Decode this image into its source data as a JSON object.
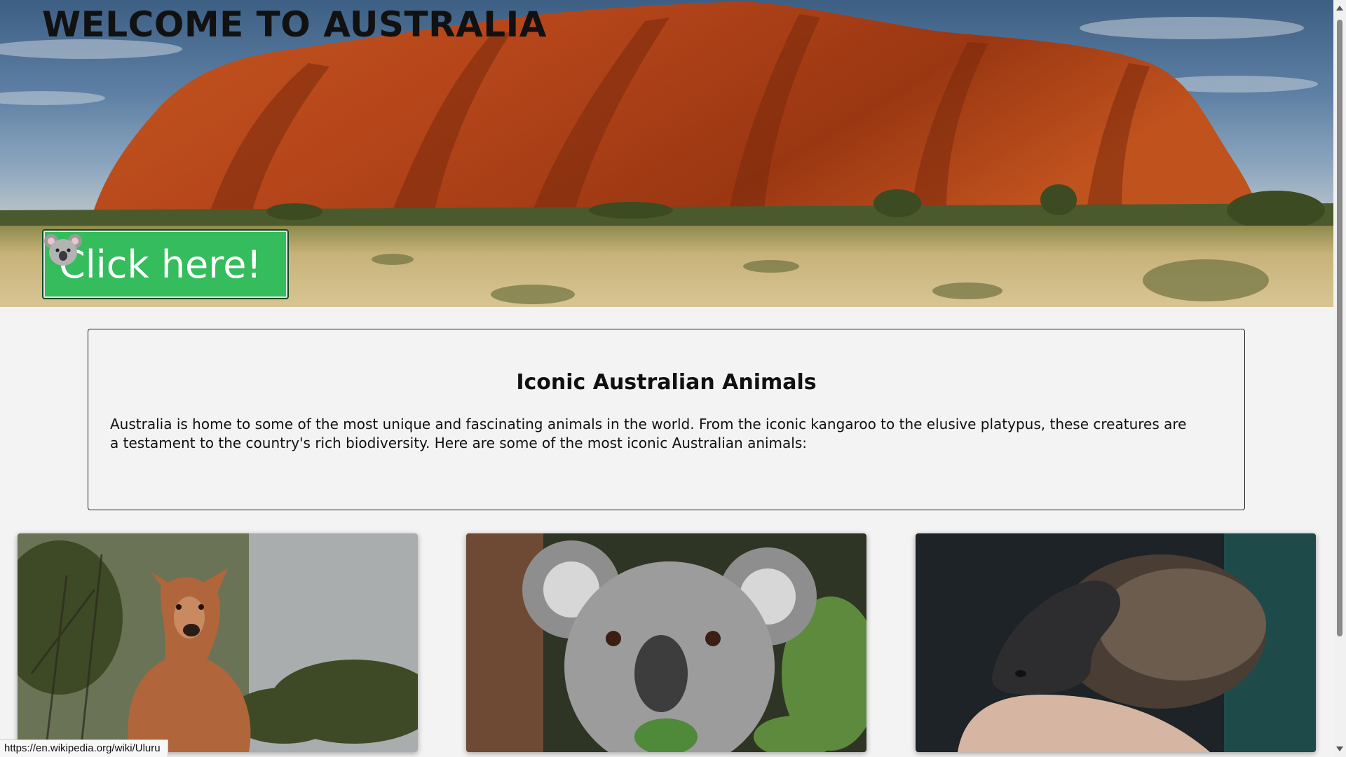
{
  "hero": {
    "title": "WELCOME TO AUSTRALIA",
    "button_label": "Click here!",
    "button_icon": "koala-emoji"
  },
  "intro": {
    "heading": "Iconic Australian Animals",
    "body": "Australia is home to some of the most unique and fascinating animals in the world. From the iconic kangaroo to the elusive platypus, these creatures are a testament to the country's rich biodiversity. Here are some of the most iconic Australian animals:"
  },
  "cards": [
    {
      "image": "kangaroo-photo"
    },
    {
      "image": "koala-photo"
    },
    {
      "image": "platypus-photo"
    }
  ],
  "status_bar": {
    "url": "https://en.wikipedia.org/wiki/Uluru"
  },
  "colors": {
    "button": "#35bc5c",
    "rock": "#b24a1c",
    "background": "#f3f3f3"
  }
}
